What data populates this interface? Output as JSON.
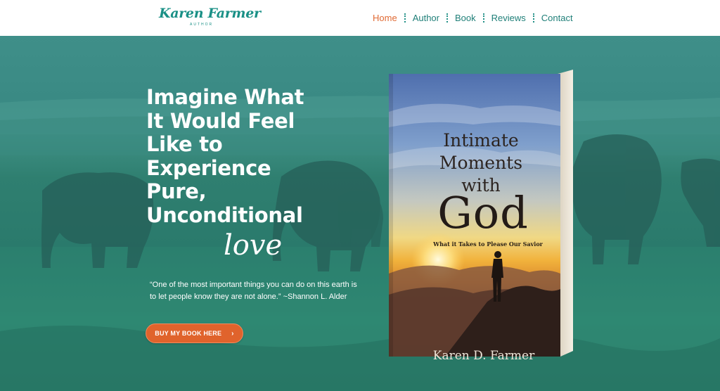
{
  "header": {
    "logo_name": "Karen Farmer",
    "logo_sub": "AUTHOR",
    "nav": [
      {
        "label": "Home",
        "active": true
      },
      {
        "label": "Author",
        "active": false
      },
      {
        "label": "Book",
        "active": false
      },
      {
        "label": "Reviews",
        "active": false
      },
      {
        "label": "Contact",
        "active": false
      }
    ]
  },
  "hero": {
    "headline_lines": [
      "Imagine What",
      "It Would Feel",
      "Like to",
      "Experience",
      "Pure,",
      "Unconditional"
    ],
    "script_word": "love",
    "quote": "“One of the most important things you can do on this earth is to let people know they are not alone.” ~Shannon L. Alder",
    "cta_label": "BUY MY BOOK HERE",
    "cta_icon": "chevron-right-icon"
  },
  "book": {
    "title_lines": [
      "Intimate",
      "Moments",
      "with"
    ],
    "title_big": "God",
    "subtitle": "What it Takes to Please Our Savior",
    "author": "Karen D. Farmer"
  },
  "colors": {
    "brand_teal": "#1a9086",
    "nav_active": "#e06a34",
    "cta_orange": "#e0632c",
    "hero_tint": "#2f8276"
  }
}
